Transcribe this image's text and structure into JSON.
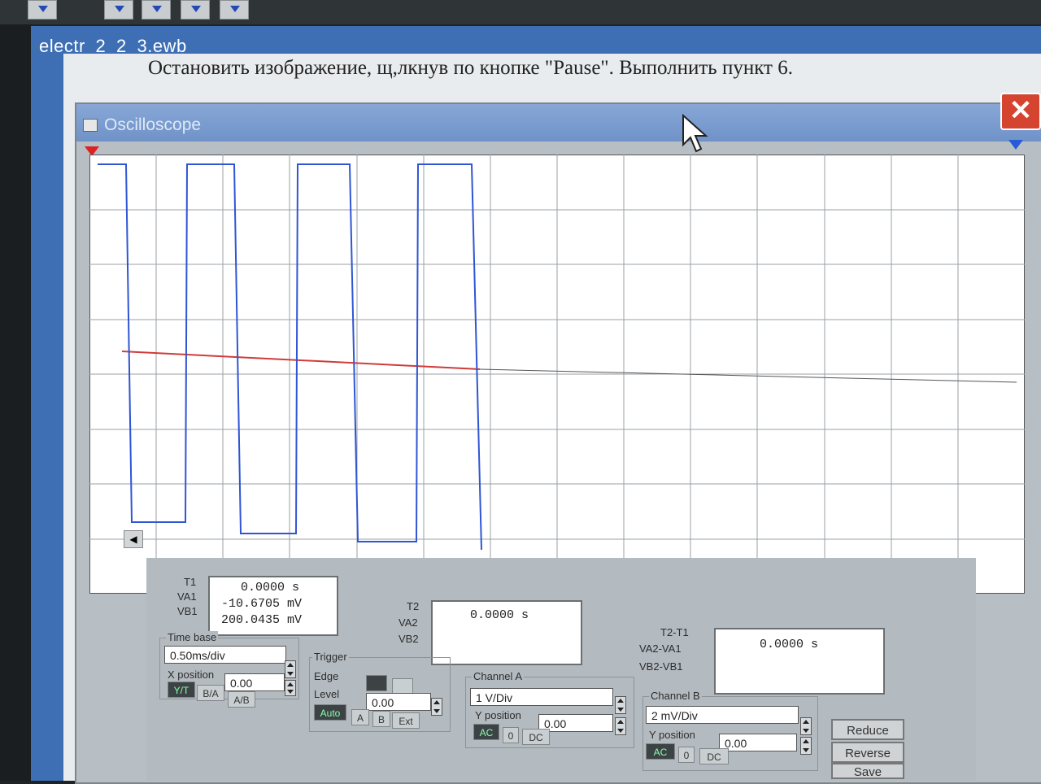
{
  "window": {
    "title": "electr_2_2_3.ewb",
    "instruction": "Остановить изображение, щ,лкнув по кнопке \"Pause\". Выполнить пункт 6."
  },
  "oscilloscope": {
    "title": "Oscilloscope",
    "close_glyph": "✕",
    "trigger_marker_1": "1",
    "trigger_marker_2": "2",
    "scroll_left_glyph": "◀",
    "scroll_right_glyph": "▶",
    "colors": {
      "channel_a": "#d13b3b",
      "channel_b": "#2f55d4",
      "grid": "#9aa2a6",
      "screen_bg": "#ffffff"
    }
  },
  "readouts": {
    "t1": {
      "labels": [
        "T1",
        "VA1",
        "VB1"
      ],
      "values": [
        "0.0000 s",
        "-10.6705 mV",
        "200.0435 mV"
      ]
    },
    "t2": {
      "labels": [
        "T2",
        "VA2",
        "VB2"
      ],
      "values": [
        "0.0000 s"
      ]
    },
    "t2_t1": {
      "labels": [
        "T2-T1",
        "VA2-VA1",
        "VB2-VB1"
      ],
      "values": [
        "0.0000 s"
      ]
    }
  },
  "time_base": {
    "title": "Time base",
    "scale": "0.50ms/div",
    "x_position_label": "X position",
    "x_position": "0.00",
    "buttons": [
      "Y/T",
      "B/A",
      "A/B"
    ]
  },
  "trigger": {
    "title": "Trigger",
    "edge_label": "Edge",
    "level_label": "Level",
    "level": "0.00",
    "buttons": [
      "Auto",
      "A",
      "B",
      "Ext"
    ]
  },
  "channel_a": {
    "title": "Channel A",
    "scale": "1 V/Div",
    "y_position_label": "Y position",
    "y_position": "0.00",
    "buttons": [
      "AC",
      "0",
      "DC"
    ]
  },
  "channel_b": {
    "title": "Channel B",
    "scale": "2 mV/Div",
    "y_position_label": "Y position",
    "y_position": "0.00",
    "buttons": [
      "AC",
      "0",
      "DC"
    ]
  },
  "actions": [
    "Reduce",
    "Reverse",
    "Save"
  ]
}
